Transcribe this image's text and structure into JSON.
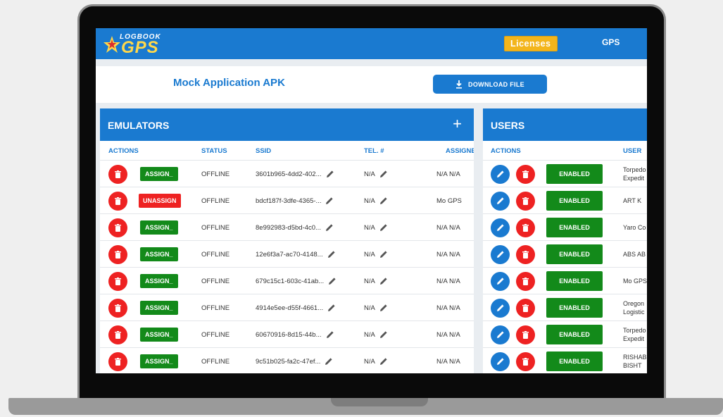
{
  "header": {
    "logo_top": "LOGBOOK",
    "logo_main": "GPS",
    "licenses_label": "Licenses",
    "gps_label": "GPS"
  },
  "apk": {
    "title": "Mock Application APK",
    "download_label": "DOWNLOAD FILE"
  },
  "emulators": {
    "title": "EMULATORS",
    "add_glyph": "+",
    "columns": [
      "ACTIONS",
      "STATUS",
      "SSID",
      "TEL. #",
      "ASSIGNE"
    ],
    "rows": [
      {
        "button": "ASSIGN_",
        "status": "OFFLINE",
        "ssid": "3601b965-4dd2-402...",
        "tel": "N/A",
        "assigned": "N/A N/A"
      },
      {
        "button": "UNASSIGN",
        "status": "OFFLINE",
        "ssid": "bdcf187f-3dfe-4365-...",
        "tel": "N/A",
        "assigned": "Mo GPS"
      },
      {
        "button": "ASSIGN_",
        "status": "OFFLINE",
        "ssid": "8e992983-d5bd-4c0...",
        "tel": "N/A",
        "assigned": "N/A N/A"
      },
      {
        "button": "ASSIGN_",
        "status": "OFFLINE",
        "ssid": "12e6f3a7-ac70-4148...",
        "tel": "N/A",
        "assigned": "N/A N/A"
      },
      {
        "button": "ASSIGN_",
        "status": "OFFLINE",
        "ssid": "679c15c1-603c-41ab...",
        "tel": "N/A",
        "assigned": "N/A N/A"
      },
      {
        "button": "ASSIGN_",
        "status": "OFFLINE",
        "ssid": "4914e5ee-d55f-4661...",
        "tel": "N/A",
        "assigned": "N/A N/A"
      },
      {
        "button": "ASSIGN_",
        "status": "OFFLINE",
        "ssid": "60670916-8d15-44b...",
        "tel": "N/A",
        "assigned": "N/A N/A"
      },
      {
        "button": "ASSIGN_",
        "status": "OFFLINE",
        "ssid": "9c51b025-fa2c-47ef...",
        "tel": "N/A",
        "assigned": "N/A N/A"
      }
    ]
  },
  "users": {
    "title": "USERS",
    "columns": [
      "ACTIONS",
      "USER"
    ],
    "rows": [
      {
        "status": "ENABLED",
        "user": "Torpedo Expedit"
      },
      {
        "status": "ENABLED",
        "user": "ART K"
      },
      {
        "status": "ENABLED",
        "user": "Yaro Co"
      },
      {
        "status": "ENABLED",
        "user": "ABS AB"
      },
      {
        "status": "ENABLED",
        "user": "Mo GPS"
      },
      {
        "status": "ENABLED",
        "user": "Oregon Logistic"
      },
      {
        "status": "ENABLED",
        "user": "Torpedo Expedit"
      },
      {
        "status": "ENABLED",
        "user": "RISHAB BISHT"
      }
    ]
  },
  "colors": {
    "primary": "#1a7ad0",
    "danger": "#ee2222",
    "success": "#138a1a",
    "warning": "#f3b51c"
  }
}
